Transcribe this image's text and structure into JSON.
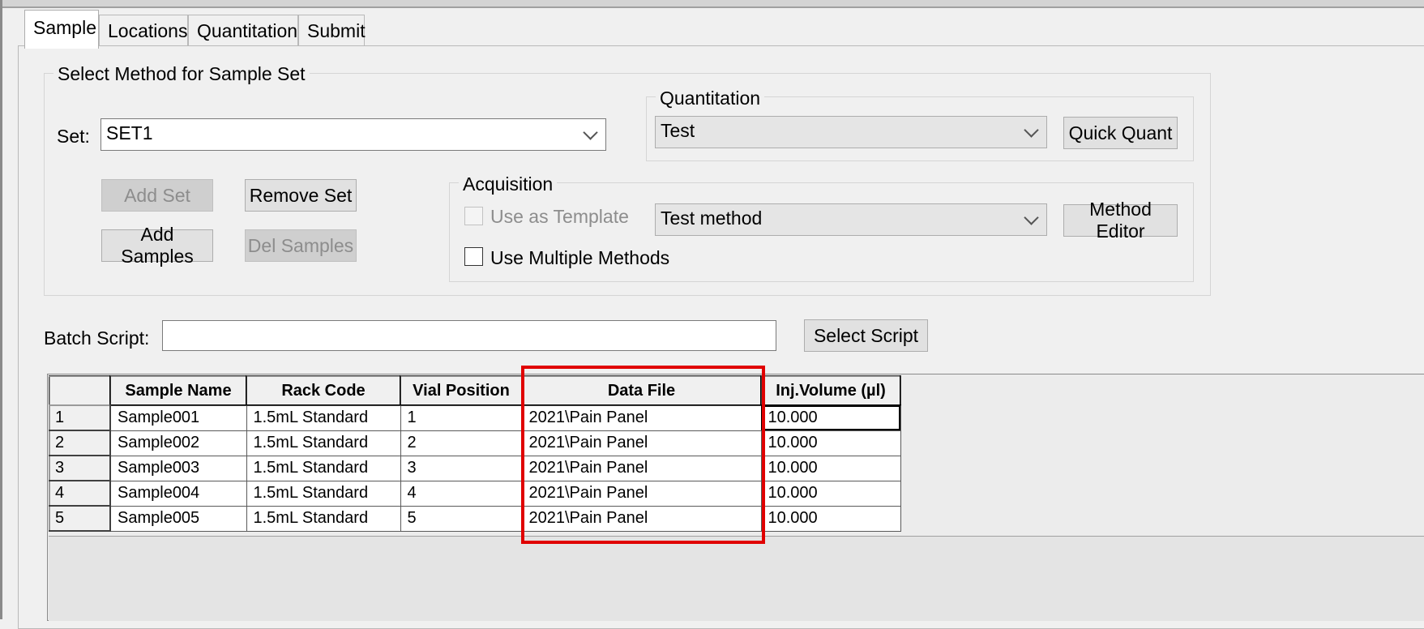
{
  "tabs": [
    {
      "label": "Sample",
      "active": true
    },
    {
      "label": "Locations",
      "active": false
    },
    {
      "label": "Quantitation",
      "active": false
    },
    {
      "label": "Submit",
      "active": false
    }
  ],
  "method_group": {
    "title": "Select Method for Sample Set",
    "set_label": "Set:",
    "set_value": "SET1",
    "add_set": "Add Set",
    "remove_set": "Remove Set",
    "add_samples": "Add Samples",
    "del_samples": "Del Samples"
  },
  "quantitation_group": {
    "title": "Quantitation",
    "value": "Test",
    "quick_quant": "Quick Quant"
  },
  "acquisition_group": {
    "title": "Acquisition",
    "use_as_template": "Use as Template",
    "use_multiple_methods": "Use Multiple Methods",
    "method_value": "Test method",
    "method_editor": "Method Editor"
  },
  "batch": {
    "label": "Batch Script:",
    "value": "",
    "select_script": "Select Script"
  },
  "grid": {
    "columns": [
      "Sample Name",
      "Rack Code",
      "Vial Position",
      "Data File",
      "Inj.Volume (µl)"
    ],
    "rows": [
      {
        "num": "1",
        "sample": "Sample001",
        "rack": "1.5mL Standard",
        "vial": "1",
        "file": "2021\\Pain Panel",
        "vol": "10.000"
      },
      {
        "num": "2",
        "sample": "Sample002",
        "rack": "1.5mL Standard",
        "vial": "2",
        "file": "2021\\Pain Panel",
        "vol": "10.000"
      },
      {
        "num": "3",
        "sample": "Sample003",
        "rack": "1.5mL Standard",
        "vial": "3",
        "file": "2021\\Pain Panel",
        "vol": "10.000"
      },
      {
        "num": "4",
        "sample": "Sample004",
        "rack": "1.5mL Standard",
        "vial": "4",
        "file": "2021\\Pain Panel",
        "vol": "10.000"
      },
      {
        "num": "5",
        "sample": "Sample005",
        "rack": "1.5mL Standard",
        "vial": "5",
        "file": "2021\\Pain Panel",
        "vol": "10.000"
      }
    ]
  },
  "colors": {
    "highlight": "#e00000",
    "window_bg": "#f0f0f0",
    "disabled_button": "#cfcfcf"
  }
}
